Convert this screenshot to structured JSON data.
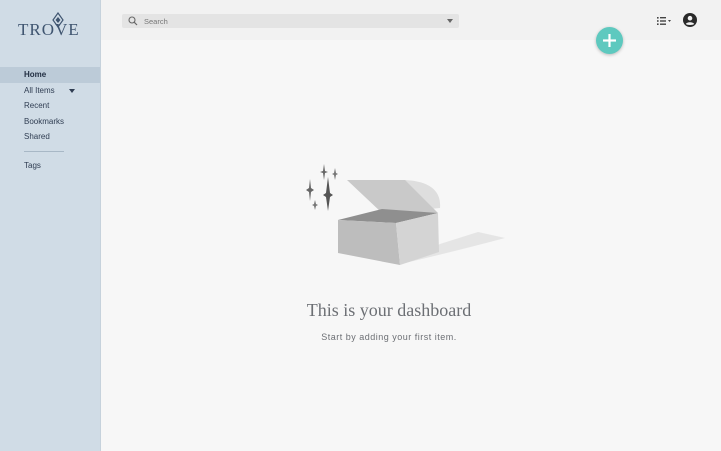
{
  "brand": {
    "name": "TROVE"
  },
  "search": {
    "placeholder": "Search"
  },
  "sidebar": {
    "items": [
      {
        "label": "Home"
      },
      {
        "label": "All Items"
      },
      {
        "label": "Recent"
      },
      {
        "label": "Bookmarks"
      },
      {
        "label": "Shared"
      }
    ],
    "secondary": [
      {
        "label": "Tags"
      }
    ]
  },
  "icons": {
    "search": "search-icon",
    "list_view": "list-view-icon",
    "account": "account-circle-icon",
    "add": "plus-icon"
  },
  "colors": {
    "sidebar": "#d0dce6",
    "sidebar_active": "#bccbd8",
    "accent": "#5ec9bf"
  },
  "empty_state": {
    "title": "This is your dashboard",
    "subtitle": "Start by adding your first item."
  }
}
